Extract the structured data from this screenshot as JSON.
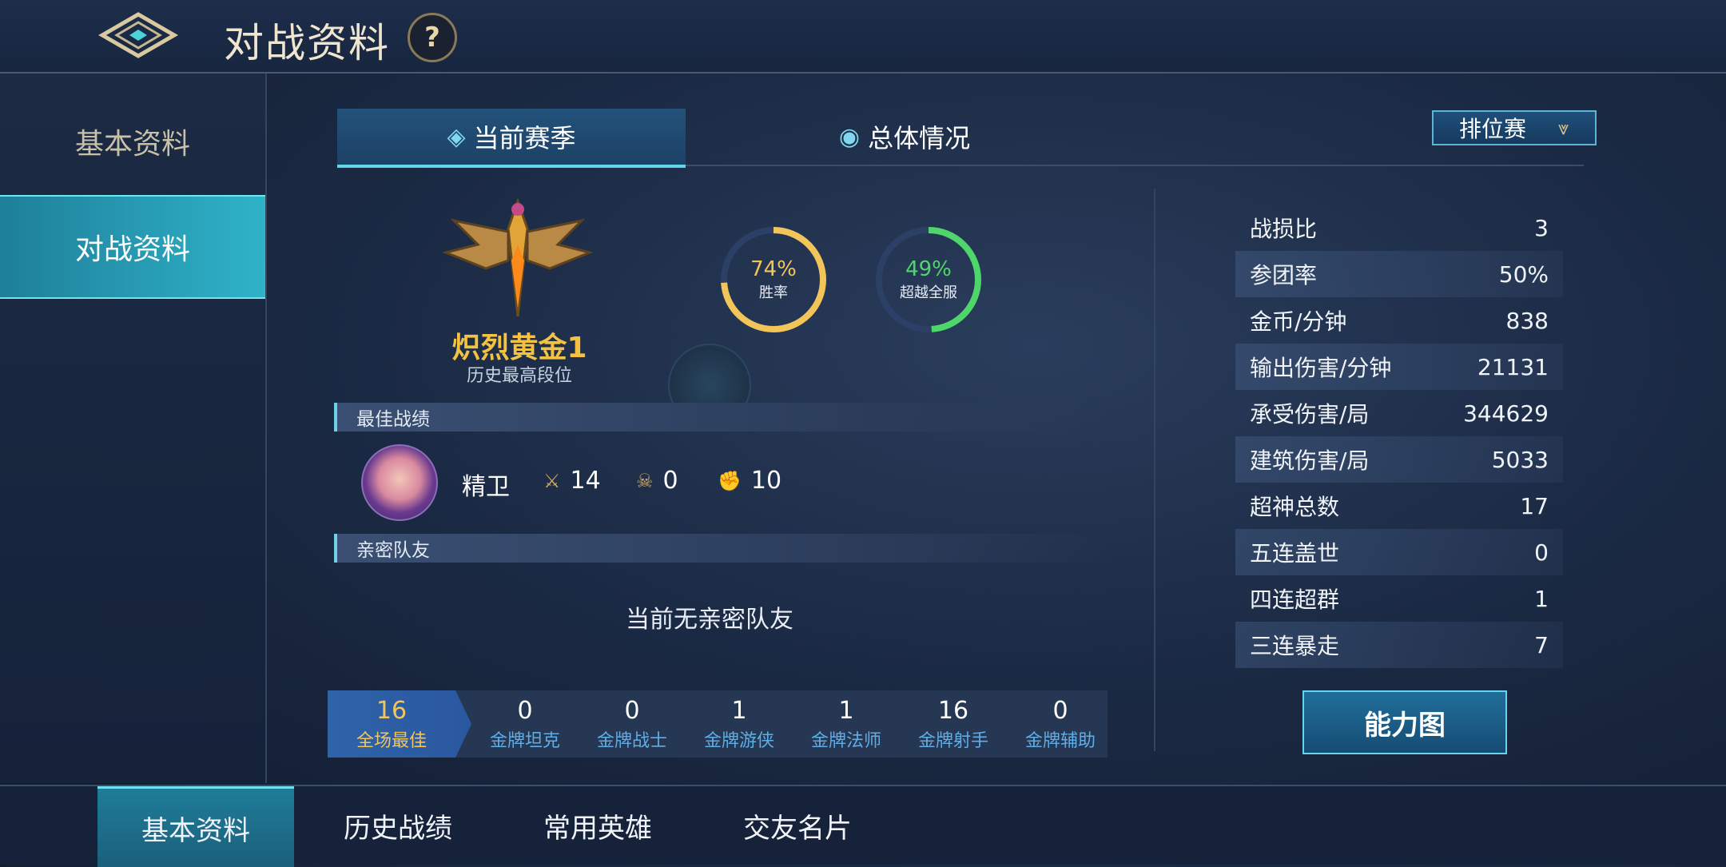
{
  "header": {
    "title": "对战资料",
    "help": "?"
  },
  "sidebar": {
    "items": [
      {
        "label": "基本资料"
      },
      {
        "label": "对战资料"
      }
    ]
  },
  "tabs": [
    {
      "label": "当前赛季"
    },
    {
      "label": "总体情况"
    }
  ],
  "mode_select": {
    "label": "排位赛"
  },
  "rank": {
    "name": "炽烈黄金1",
    "sub": "历史最高段位"
  },
  "rings": [
    {
      "value": "74%",
      "label": "胜率",
      "percent": 74,
      "color": "#f2c55a"
    },
    {
      "value": "49%",
      "label": "超越全服",
      "percent": 49,
      "color": "#4fd66a"
    }
  ],
  "best_record": {
    "title": "最佳战绩",
    "hero": "精卫",
    "kills": "14",
    "deaths": "0",
    "assists": "10"
  },
  "close_friends": {
    "title": "亲密队友",
    "empty": "当前无亲密队友"
  },
  "medals": [
    {
      "num": "16",
      "label": "全场最佳"
    },
    {
      "num": "0",
      "label": "金牌坦克"
    },
    {
      "num": "0",
      "label": "金牌战士"
    },
    {
      "num": "1",
      "label": "金牌游侠"
    },
    {
      "num": "1",
      "label": "金牌法师"
    },
    {
      "num": "16",
      "label": "金牌射手"
    },
    {
      "num": "0",
      "label": "金牌辅助"
    }
  ],
  "stats": [
    {
      "label": "战损比",
      "value": "3"
    },
    {
      "label": "参团率",
      "value": "50%"
    },
    {
      "label": "金币/分钟",
      "value": "838"
    },
    {
      "label": "输出伤害/分钟",
      "value": "21131"
    },
    {
      "label": "承受伤害/局",
      "value": "344629"
    },
    {
      "label": "建筑伤害/局",
      "value": "5033"
    },
    {
      "label": "超神总数",
      "value": "17"
    },
    {
      "label": "五连盖世",
      "value": "0"
    },
    {
      "label": "四连超群",
      "value": "1"
    },
    {
      "label": "三连暴走",
      "value": "7"
    }
  ],
  "ability_button": {
    "label": "能力图"
  },
  "bottom_tabs": [
    {
      "label": "基本资料"
    },
    {
      "label": "历史战绩"
    },
    {
      "label": "常用英雄"
    },
    {
      "label": "交友名片"
    }
  ]
}
